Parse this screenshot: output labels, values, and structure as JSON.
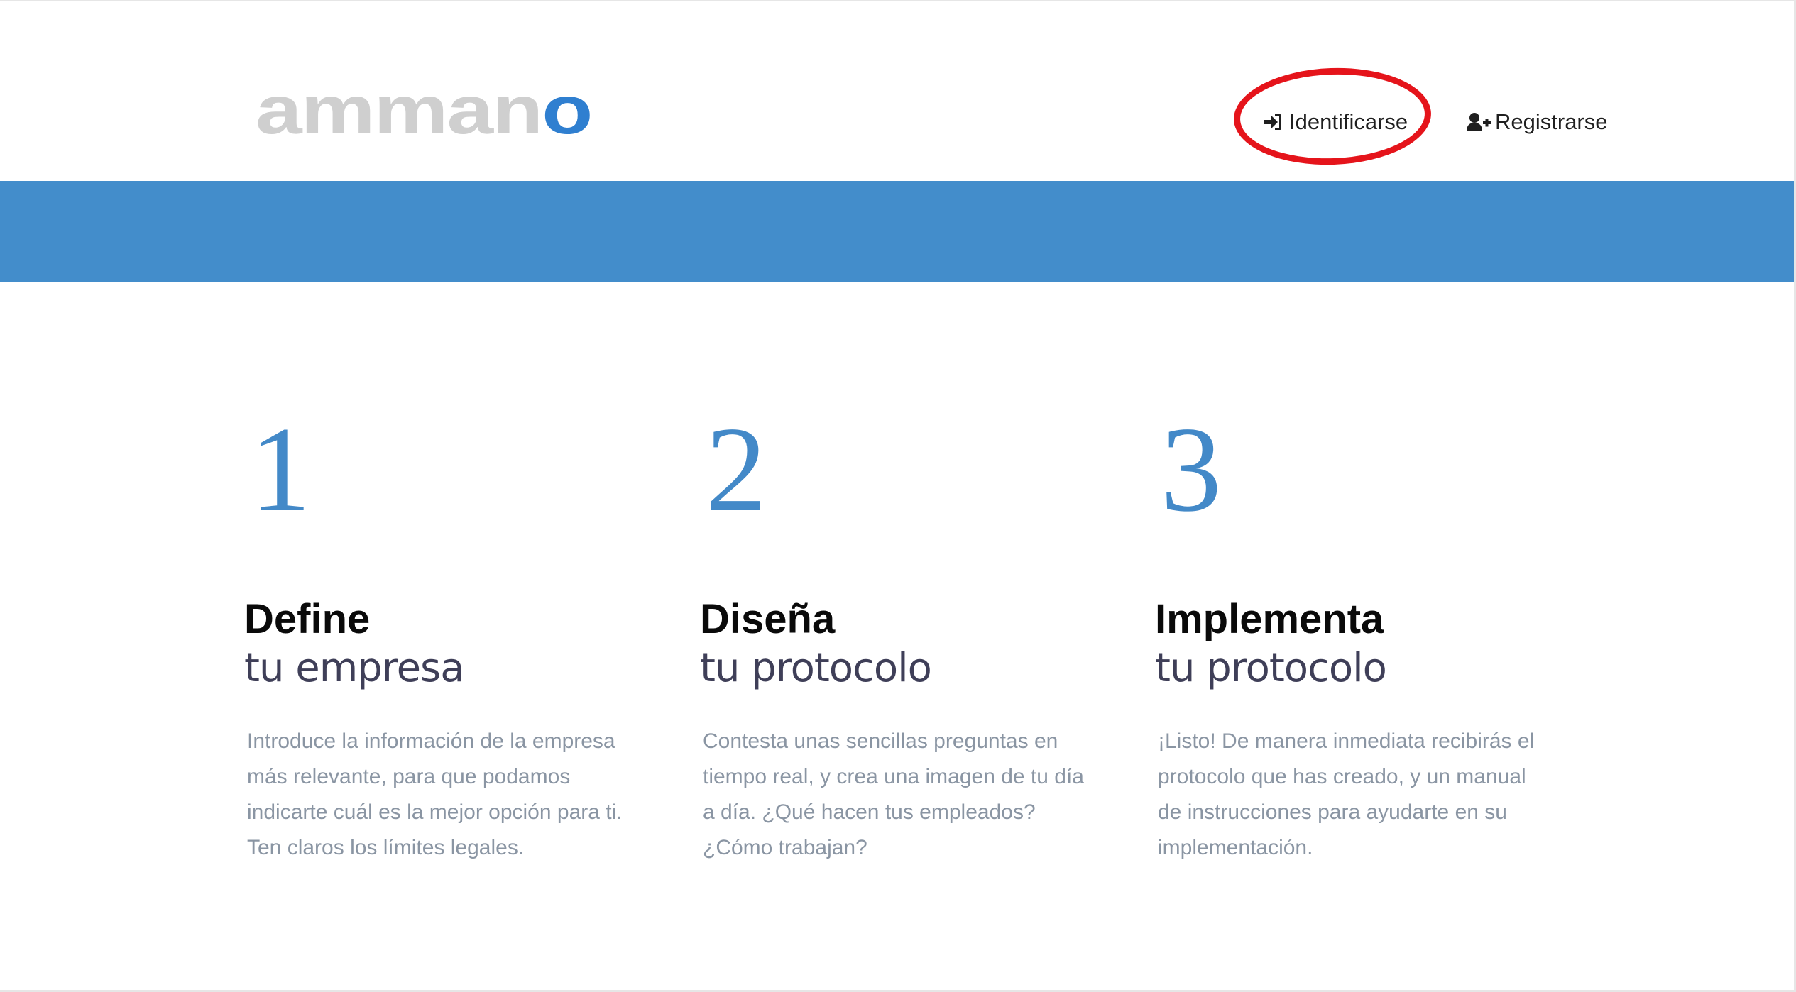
{
  "header": {
    "logo": {
      "text_main": "ammano",
      "text_accent": "",
      "accent_color": "#2f7fd0"
    },
    "nav": {
      "login": {
        "label": "Identificarse",
        "icon": "sign-in-icon"
      },
      "register": {
        "label": "Registrarse",
        "icon": "user-plus-icon"
      }
    }
  },
  "band": {
    "color": "#438dcb"
  },
  "steps": [
    {
      "number": "1",
      "title": "Define",
      "subtitle": "tu empresa",
      "description": "Introduce la información de la empresa más relevante, para que podamos indicarte cuál es la mejor opción para ti. Ten claros los límites legales."
    },
    {
      "number": "2",
      "title": "Diseña",
      "subtitle": "tu protocolo",
      "description": "Contesta unas sencillas preguntas en tiempo real, y crea una imagen de tu día a día. ¿Qué hacen tus empleados? ¿Cómo trabajan?"
    },
    {
      "number": "3",
      "title": "Implementa",
      "subtitle": "tu protocolo",
      "description": "¡Listo! De manera inmediata recibirás el protocolo que has creado, y un manual de instrucciones para ayudarte en su implementación."
    }
  ],
  "colors": {
    "accent": "#4389c8",
    "highlight_ring": "#e5141b"
  }
}
